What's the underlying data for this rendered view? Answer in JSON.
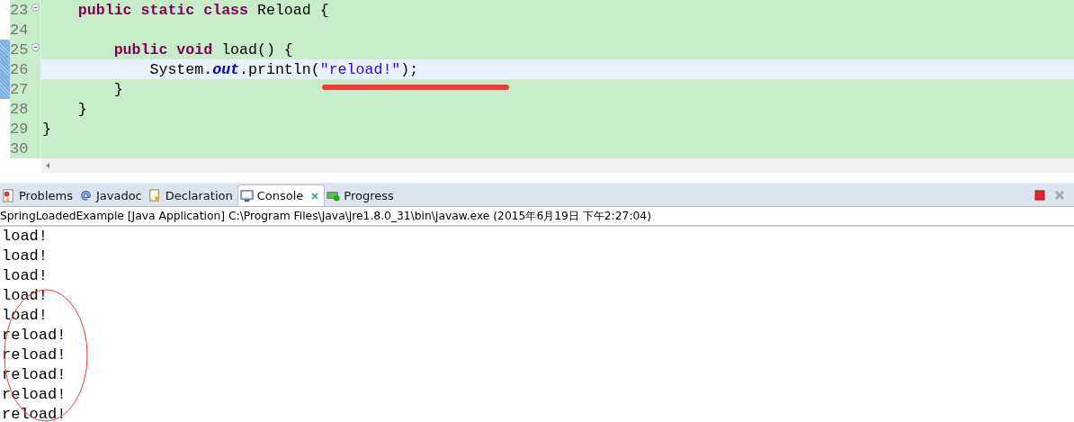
{
  "editor": {
    "lines": [
      {
        "number": "23",
        "fold": true,
        "changed": false,
        "current": false,
        "tokens": [
          {
            "kind": "keyword",
            "text": "    public static class"
          },
          {
            "kind": "plain",
            "text": " Reload {"
          }
        ]
      },
      {
        "number": "24",
        "fold": false,
        "changed": false,
        "current": false
      },
      {
        "number": "25",
        "fold": true,
        "changed": true,
        "current": false,
        "tokens": [
          {
            "kind": "keyword",
            "text": "        public void"
          },
          {
            "kind": "plain",
            "text": " load() {"
          }
        ]
      },
      {
        "number": "26",
        "fold": false,
        "changed": true,
        "current": true,
        "tokens": [
          {
            "kind": "plain",
            "text": "            System."
          },
          {
            "kind": "field",
            "text": "out"
          },
          {
            "kind": "plain",
            "text": ".println("
          },
          {
            "kind": "string",
            "text": "\"reload!\""
          },
          {
            "kind": "plain",
            "text": ");"
          }
        ]
      },
      {
        "number": "27",
        "fold": false,
        "changed": true,
        "current": false,
        "tokens": [
          {
            "kind": "plain",
            "text": "        }"
          }
        ]
      },
      {
        "number": "28",
        "fold": false,
        "changed": false,
        "current": false,
        "tokens": [
          {
            "kind": "plain",
            "text": "    }"
          }
        ]
      },
      {
        "number": "29",
        "fold": false,
        "changed": false,
        "current": false,
        "tokens": [
          {
            "kind": "plain",
            "text": "}"
          }
        ]
      },
      {
        "number": "30",
        "fold": false,
        "changed": false,
        "current": false
      }
    ]
  },
  "tabs": [
    {
      "label": "Problems",
      "selected": false
    },
    {
      "label": "Javadoc",
      "selected": false
    },
    {
      "label": "Declaration",
      "selected": false
    },
    {
      "label": "Console",
      "selected": true
    },
    {
      "label": "Progress",
      "selected": false
    }
  ],
  "console": {
    "title": "SpringLoadedExample [Java Application] C:\\Program Files\\Java\\jre1.8.0_31\\bin\\javaw.exe (2015年6月19日 下午2:27:04)",
    "output": [
      "load!",
      "load!",
      "load!",
      "load!",
      "load!",
      "reload!",
      "reload!",
      "reload!",
      "reload!",
      "reload!"
    ]
  }
}
